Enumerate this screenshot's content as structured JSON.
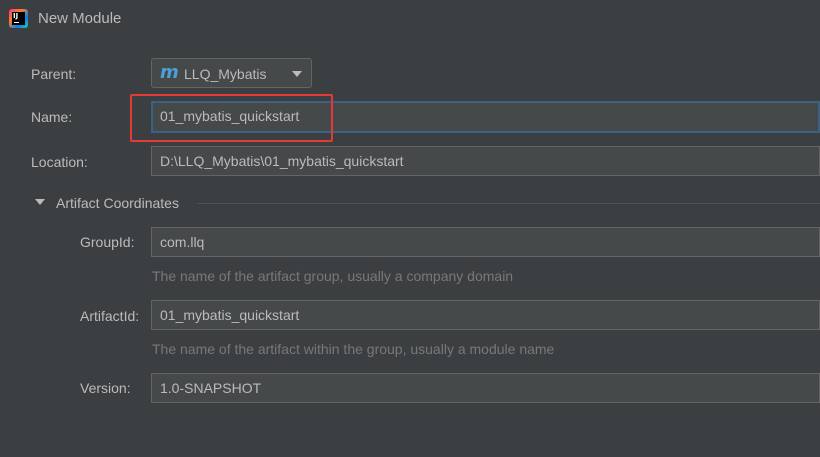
{
  "window": {
    "title": "New Module",
    "icon": "intellij-idea-icon",
    "icon_text": "IJ"
  },
  "form": {
    "parent": {
      "label": "Parent:",
      "value": "LLQ_Mybatis",
      "icon": "maven-module-icon",
      "icon_glyph": "m"
    },
    "name": {
      "label": "Name:",
      "value": "01_mybatis_quickstart"
    },
    "location": {
      "label": "Location:",
      "value": "D:\\LLQ_Mybatis\\01_mybatis_quickstart"
    }
  },
  "artifact": {
    "section_title": "Artifact Coordinates",
    "expanded": true,
    "group_id": {
      "label": "GroupId:",
      "value": "com.llq",
      "hint": "The name of the artifact group, usually a company domain"
    },
    "artifact_id": {
      "label": "ArtifactId:",
      "value": "01_mybatis_quickstart",
      "hint": "The name of the artifact within the group, usually a module name"
    },
    "version": {
      "label": "Version:",
      "value": "1.0-SNAPSHOT"
    }
  },
  "colors": {
    "background": "#3c3f41",
    "field_background": "#45494a",
    "focus_border": "#3d6185",
    "annotation_red": "#e53935",
    "maven_blue": "#4aa0d8"
  }
}
